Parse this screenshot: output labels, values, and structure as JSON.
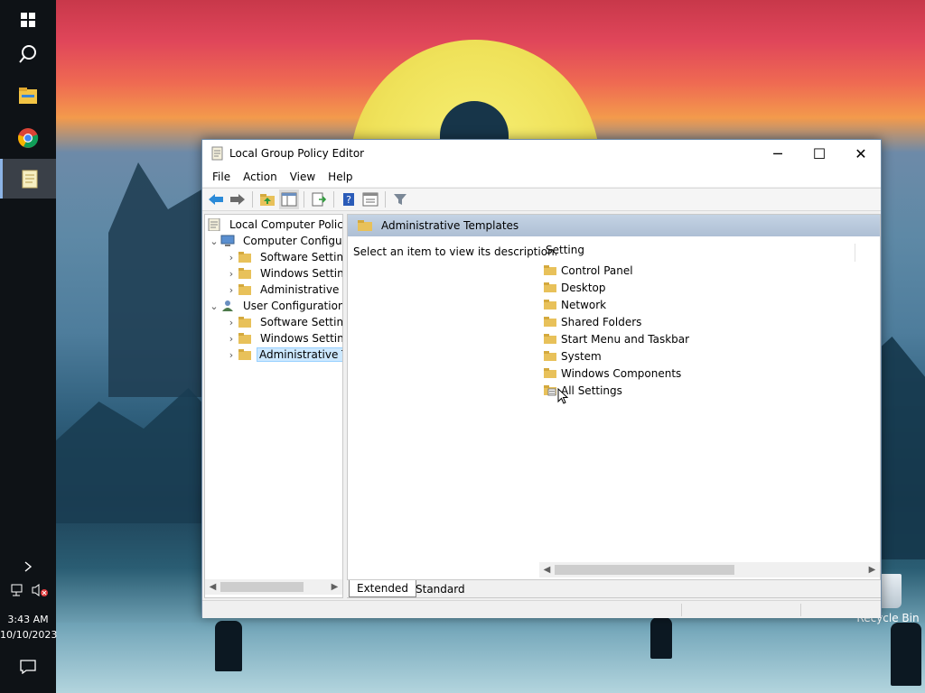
{
  "taskbar": {
    "time": "3:43 AM",
    "date": "10/10/2023",
    "icons": [
      "windows-start-icon",
      "search-icon",
      "file-explorer-icon",
      "chrome-icon",
      "notepad-icon",
      "chevron-right-icon",
      "network-icon",
      "volume-muted-icon",
      "notification-icon"
    ]
  },
  "desktop": {
    "recycle_bin_label": "Recycle Bin"
  },
  "window": {
    "title": "Local Group Policy Editor",
    "controls": {
      "minimize": "─",
      "maximize": "☐",
      "close": "✕"
    },
    "menu": [
      "File",
      "Action",
      "View",
      "Help"
    ],
    "toolbar": [
      "back-icon",
      "forward-icon",
      "up-folder-icon",
      "show-hide-tree-icon",
      "export-list-icon",
      "help-icon",
      "properties-icon",
      "filter-icon"
    ],
    "tree": {
      "root": "Local Computer Policy",
      "computer_config": "Computer Configura",
      "cc_software": "Software Settings",
      "cc_windows": "Windows Setting",
      "cc_admin": "Administrative Te",
      "user_config": "User Configuration",
      "uc_software": "Software Settings",
      "uc_windows": "Windows Setting",
      "uc_admin": "Administrative Te"
    },
    "right_pane": {
      "header": "Administrative Templates",
      "description": "Select an item to view its description.",
      "column_header": "Setting",
      "items": [
        "Control Panel",
        "Desktop",
        "Network",
        "Shared Folders",
        "Start Menu and Taskbar",
        "System",
        "Windows Components",
        "All Settings"
      ]
    },
    "tabs": {
      "extended": "Extended",
      "standard": "Standard",
      "active": "Extended"
    }
  },
  "colors": {
    "taskbar": "#0e1216",
    "selection": "#cce8ff",
    "header_band": "#b9c9dc",
    "folder": "#e8c15a"
  }
}
